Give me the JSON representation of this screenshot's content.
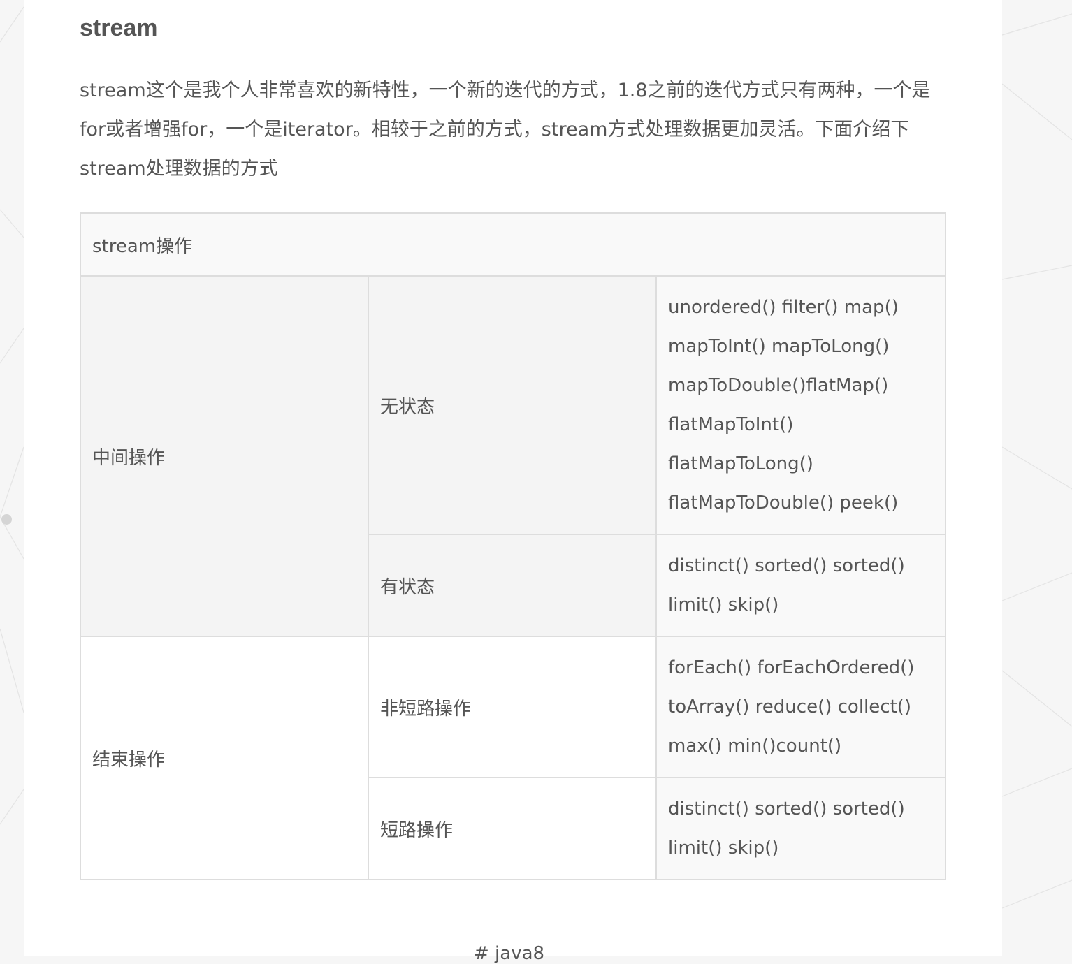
{
  "article": {
    "heading": "stream",
    "intro": "stream这个是我个人非常喜欢的新特性，一个新的迭代的方式，1.8之前的迭代方式只有两种，一个是for或者增强for，一个是iterator。相较于之前的方式，stream方式处理数据更加灵活。下面介绍下stream处理数据的方式"
  },
  "table": {
    "header": "stream操作",
    "groups": [
      {
        "label": "中间操作",
        "rows": [
          {
            "label": "无状态",
            "methods": [
              "unordered() filter() map()",
              "mapToInt() mapToLong()",
              "mapToDouble()flatMap()",
              "flatMapToInt()",
              "flatMapToLong()",
              "flatMapToDouble() peek()"
            ]
          },
          {
            "label": "有状态",
            "methods": [
              "distinct() sorted() sorted()",
              "limit() skip()"
            ]
          }
        ]
      },
      {
        "label": "结束操作",
        "rows": [
          {
            "label": "非短路操作",
            "methods": [
              "forEach() forEachOrdered()",
              "toArray() reduce() collect()",
              "max() min()count()"
            ]
          },
          {
            "label": "短路操作",
            "methods": [
              "distinct() sorted() sorted()",
              "limit() skip()"
            ]
          }
        ]
      }
    ]
  },
  "footer": {
    "tag": "# java8"
  },
  "colors": {
    "background": "#f6f6f6",
    "page": "#ffffff",
    "text": "#555555",
    "border": "#dddddd"
  }
}
